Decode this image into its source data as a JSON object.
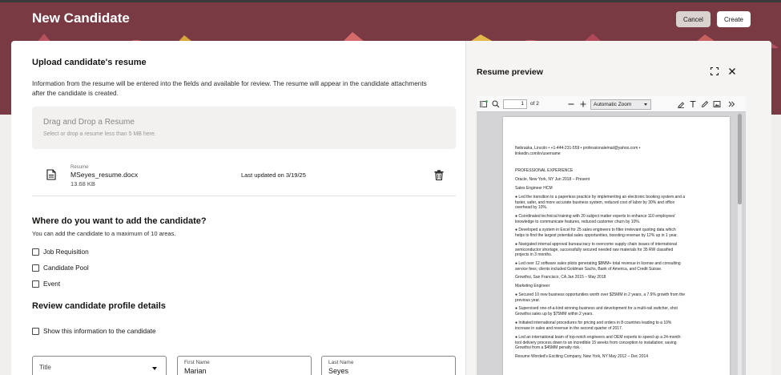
{
  "header": {
    "title": "New Candidate",
    "cancel_label": "Cancel",
    "create_label": "Create"
  },
  "upload": {
    "heading": "Upload candidate's resume",
    "description": "Information from the resume will be entered into the fields and available for review. The resume will appear in the candidate attachments after the candidate is created.",
    "dropzone_title": "Drag and Drop a Resume",
    "dropzone_subtitle": "Select or drop a resume less than 5 MB here."
  },
  "file": {
    "label": "Resume",
    "name": "MSeyes_resume.docx",
    "size": "13.68 KB",
    "updated": "Last updated on 3/19/25"
  },
  "where": {
    "heading": "Where do you want to add the candidate?",
    "subtitle": "You can add the candidate to a maximum of 10 areas.",
    "options": [
      "Job Requisition",
      "Candidate Pool",
      "Event"
    ]
  },
  "review": {
    "heading": "Review candidate profile details",
    "show_info_label": "Show this information to the candidate"
  },
  "fields": {
    "title_placeholder": "Title",
    "first_name_label": "First Name",
    "first_name_value": "Marian",
    "last_name_label": "Last Name",
    "last_name_value": "Seyes"
  },
  "preview": {
    "title": "Resume preview",
    "page_number": "1",
    "page_of": "of 2",
    "zoom": "Automatic Zoom",
    "doc_lines": [
      "Nebraska, Lincoln • +1-444-231-559 • professionalemail@yahoo.com •",
      "linkedin.com/in/username",
      "PROFESSIONAL EXPERIENCE",
      "Oracle, New York, NY Jun 2018 – Present",
      "Sales Engineer HCM",
      "● Led the transition to a paperless practice by implementing an electronic booking system and a",
      "faster, safer, and more accurate business system, reduced cost of labor by 30% and office",
      "overhead by 10%.",
      "● Coordinated technical training with 20 subject matter experts to enhance 110 employees'",
      "knowledge to communicate features, reduced customer churn by 10%.",
      "● Developed a system in Excel for 25 sales engineers to filter irrelevant quoting data which",
      "helps to find the largest potential sales opportunities, boosting revenue by 12% up in 1 year.",
      "● Navigated internal approval bureaucracy to overcome supply chain issues of international",
      "semiconductor shortage, successfully secured needed raw materials for 35 RW classified",
      "projects in 3 months.",
      "● Led over 12 software sales pilots generating $8MM+ total revenue in license and consulting",
      "service fees; clients included Goldman Sachs, Bank of America, and Credit Suisse.",
      "Growthsi, San Francisco, CA Jan 2015 – May 2018",
      "Marketing Engineer",
      "● Secured 10 new business opportunities worth over $25MM in 2 years, a 7.9% growth from the",
      "previous year.",
      "● Supervised one-of-a-kind winning business and development for a multi-rail switcher, shot",
      "Growthsi sales up by $75MM within 2 years.",
      "● Initiated international procedures for pricing and orders in 8 countries leading to a 10%",
      "increase in sales and revenue in the second quarter of 2017.",
      "● Led an international team of top-notch engineers and OEM experts to speed up a 24-month",
      "tool delivery process down to an incredible 15 weeks from conception to installation; saving",
      "Growthsi from a $45MM penalty risk.",
      "Resume Worded's Exciting Company, New York, NY May 2012 – Dec 2014"
    ]
  }
}
